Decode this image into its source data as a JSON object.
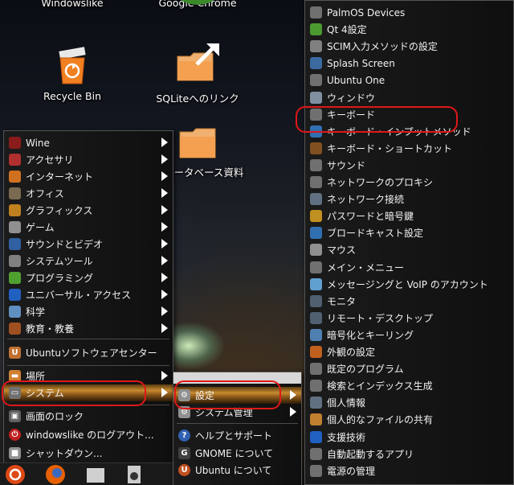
{
  "desktop": {
    "icons": [
      {
        "label": "Windowslike",
        "icon": "folder-icon"
      },
      {
        "label": "Google Chrome",
        "icon": "chrome-icon"
      },
      {
        "label": "Recycle Bin",
        "icon": "recycle-bin-icon"
      },
      {
        "label": "SQLiteへのリンク",
        "icon": "folder-link-icon"
      },
      {
        "label": "ータベース資料",
        "icon": "folder-icon"
      }
    ]
  },
  "main_menu": {
    "items": [
      {
        "label": "Wine",
        "icon": "wine-icon",
        "color": "#8a1c1c",
        "submenu": true
      },
      {
        "label": "アクセサリ",
        "icon": "accessories-icon",
        "color": "#b03030",
        "submenu": true
      },
      {
        "label": "インターネット",
        "icon": "internet-icon",
        "color": "#d07020",
        "submenu": true
      },
      {
        "label": "オフィス",
        "icon": "office-icon",
        "color": "#7a6a50",
        "submenu": true
      },
      {
        "label": "グラフィックス",
        "icon": "graphics-icon",
        "color": "#c08020",
        "submenu": true
      },
      {
        "label": "ゲーム",
        "icon": "games-icon",
        "color": "#909090",
        "submenu": true
      },
      {
        "label": "サウンドとビデオ",
        "icon": "sound-video-icon",
        "color": "#3060a0",
        "submenu": true
      },
      {
        "label": "システムツール",
        "icon": "system-tools-icon",
        "color": "#808080",
        "submenu": true
      },
      {
        "label": "プログラミング",
        "icon": "programming-icon",
        "color": "#50a030",
        "submenu": true
      },
      {
        "label": "ユニバーサル・アクセス",
        "icon": "accessibility-icon",
        "color": "#2060c0",
        "submenu": true
      },
      {
        "label": "科学",
        "icon": "science-icon",
        "color": "#6090c0",
        "submenu": true
      },
      {
        "label": "教育・教養",
        "icon": "education-icon",
        "color": "#a05020",
        "submenu": true
      }
    ],
    "software_center": {
      "label": "Ubuntuソフトウェアセンター",
      "icon": "software-center-icon",
      "color": "#c07030"
    },
    "places": {
      "label": "場所",
      "icon": "places-icon",
      "color": "#d08030"
    },
    "system": {
      "label": "システム",
      "icon": "system-icon",
      "color": "#707070"
    },
    "lock": {
      "label": "画面のロック",
      "icon": "lock-screen-icon",
      "color": "#606060"
    },
    "logout": {
      "label": "windowslike のログアウト...",
      "icon": "logout-icon",
      "color": "#c02020"
    },
    "shutdown": {
      "label": "シャットダウン...",
      "icon": "shutdown-icon",
      "color": "#909090"
    }
  },
  "system_submenu": {
    "items": [
      {
        "label": "設定",
        "icon": "settings-icon",
        "color": "#909090",
        "submenu": true
      },
      {
        "label": "システム管理",
        "icon": "admin-icon",
        "color": "#909090",
        "submenu": true
      },
      {
        "label": "ヘルプとサポート",
        "icon": "help-icon",
        "color": "#3060b0"
      },
      {
        "label": "GNOME について",
        "icon": "gnome-icon",
        "color": "#404040"
      },
      {
        "label": "Ubuntu について",
        "icon": "ubuntu-icon",
        "color": "#c05020"
      }
    ]
  },
  "settings_menu": {
    "items": [
      {
        "label": "PalmOS Devices",
        "icon": "palm-icon",
        "color": "#707070"
      },
      {
        "label": "Qt 4設定",
        "icon": "qt-icon",
        "color": "#4a9a30"
      },
      {
        "label": "SCIM入力メソッドの設定",
        "icon": "scim-icon",
        "color": "#808080"
      },
      {
        "label": "Splash Screen",
        "icon": "splash-icon",
        "color": "#3a6aa0"
      },
      {
        "label": "Ubuntu One",
        "icon": "ubuntu-one-icon",
        "color": "#707070"
      },
      {
        "label": "ウィンドウ",
        "icon": "window-icon",
        "color": "#8090a0"
      },
      {
        "label": "キーボード",
        "icon": "keyboard-icon",
        "color": "#707070"
      },
      {
        "label": "キーボード・インプットメソッド",
        "icon": "input-method-icon",
        "color": "#3070b0"
      },
      {
        "label": "キーボード・ショートカット",
        "icon": "shortcut-icon",
        "color": "#805020"
      },
      {
        "label": "サウンド",
        "icon": "sound-icon",
        "color": "#707070"
      },
      {
        "label": "ネットワークのプロキシ",
        "icon": "proxy-icon",
        "color": "#707070"
      },
      {
        "label": "ネットワーク接続",
        "icon": "network-icon",
        "color": "#607080"
      },
      {
        "label": "パスワードと暗号鍵",
        "icon": "key-icon",
        "color": "#c09020"
      },
      {
        "label": "ブロードキャスト設定",
        "icon": "broadcast-icon",
        "color": "#3070b0"
      },
      {
        "label": "マウス",
        "icon": "mouse-icon",
        "color": "#909090"
      },
      {
        "label": "メイン・メニュー",
        "icon": "main-menu-icon",
        "color": "#707070"
      },
      {
        "label": "メッセージングと VoIP のアカウント",
        "icon": "messaging-icon",
        "color": "#60a0d0"
      },
      {
        "label": "モニタ",
        "icon": "monitor-icon",
        "color": "#506070"
      },
      {
        "label": "リモート・デスクトップ",
        "icon": "remote-desktop-icon",
        "color": "#506070"
      },
      {
        "label": "暗号化とキーリング",
        "icon": "keyring-icon",
        "color": "#5080b0"
      },
      {
        "label": "外観の設定",
        "icon": "appearance-icon",
        "color": "#c06020"
      },
      {
        "label": "既定のプログラム",
        "icon": "default-apps-icon",
        "color": "#707070"
      },
      {
        "label": "検索とインデックス生成",
        "icon": "search-icon",
        "color": "#707070"
      },
      {
        "label": "個人情報",
        "icon": "personal-info-icon",
        "color": "#607080"
      },
      {
        "label": "個人的なファイルの共有",
        "icon": "file-share-icon",
        "color": "#c08030"
      },
      {
        "label": "支援技術",
        "icon": "assistive-icon",
        "color": "#2060c0"
      },
      {
        "label": "自動起動するアプリ",
        "icon": "autostart-icon",
        "color": "#707070"
      },
      {
        "label": "電源の管理",
        "icon": "power-icon",
        "color": "#707070"
      }
    ]
  },
  "colors": {
    "highlight": "#c68a2f",
    "annotation_ring": "#e01818"
  }
}
